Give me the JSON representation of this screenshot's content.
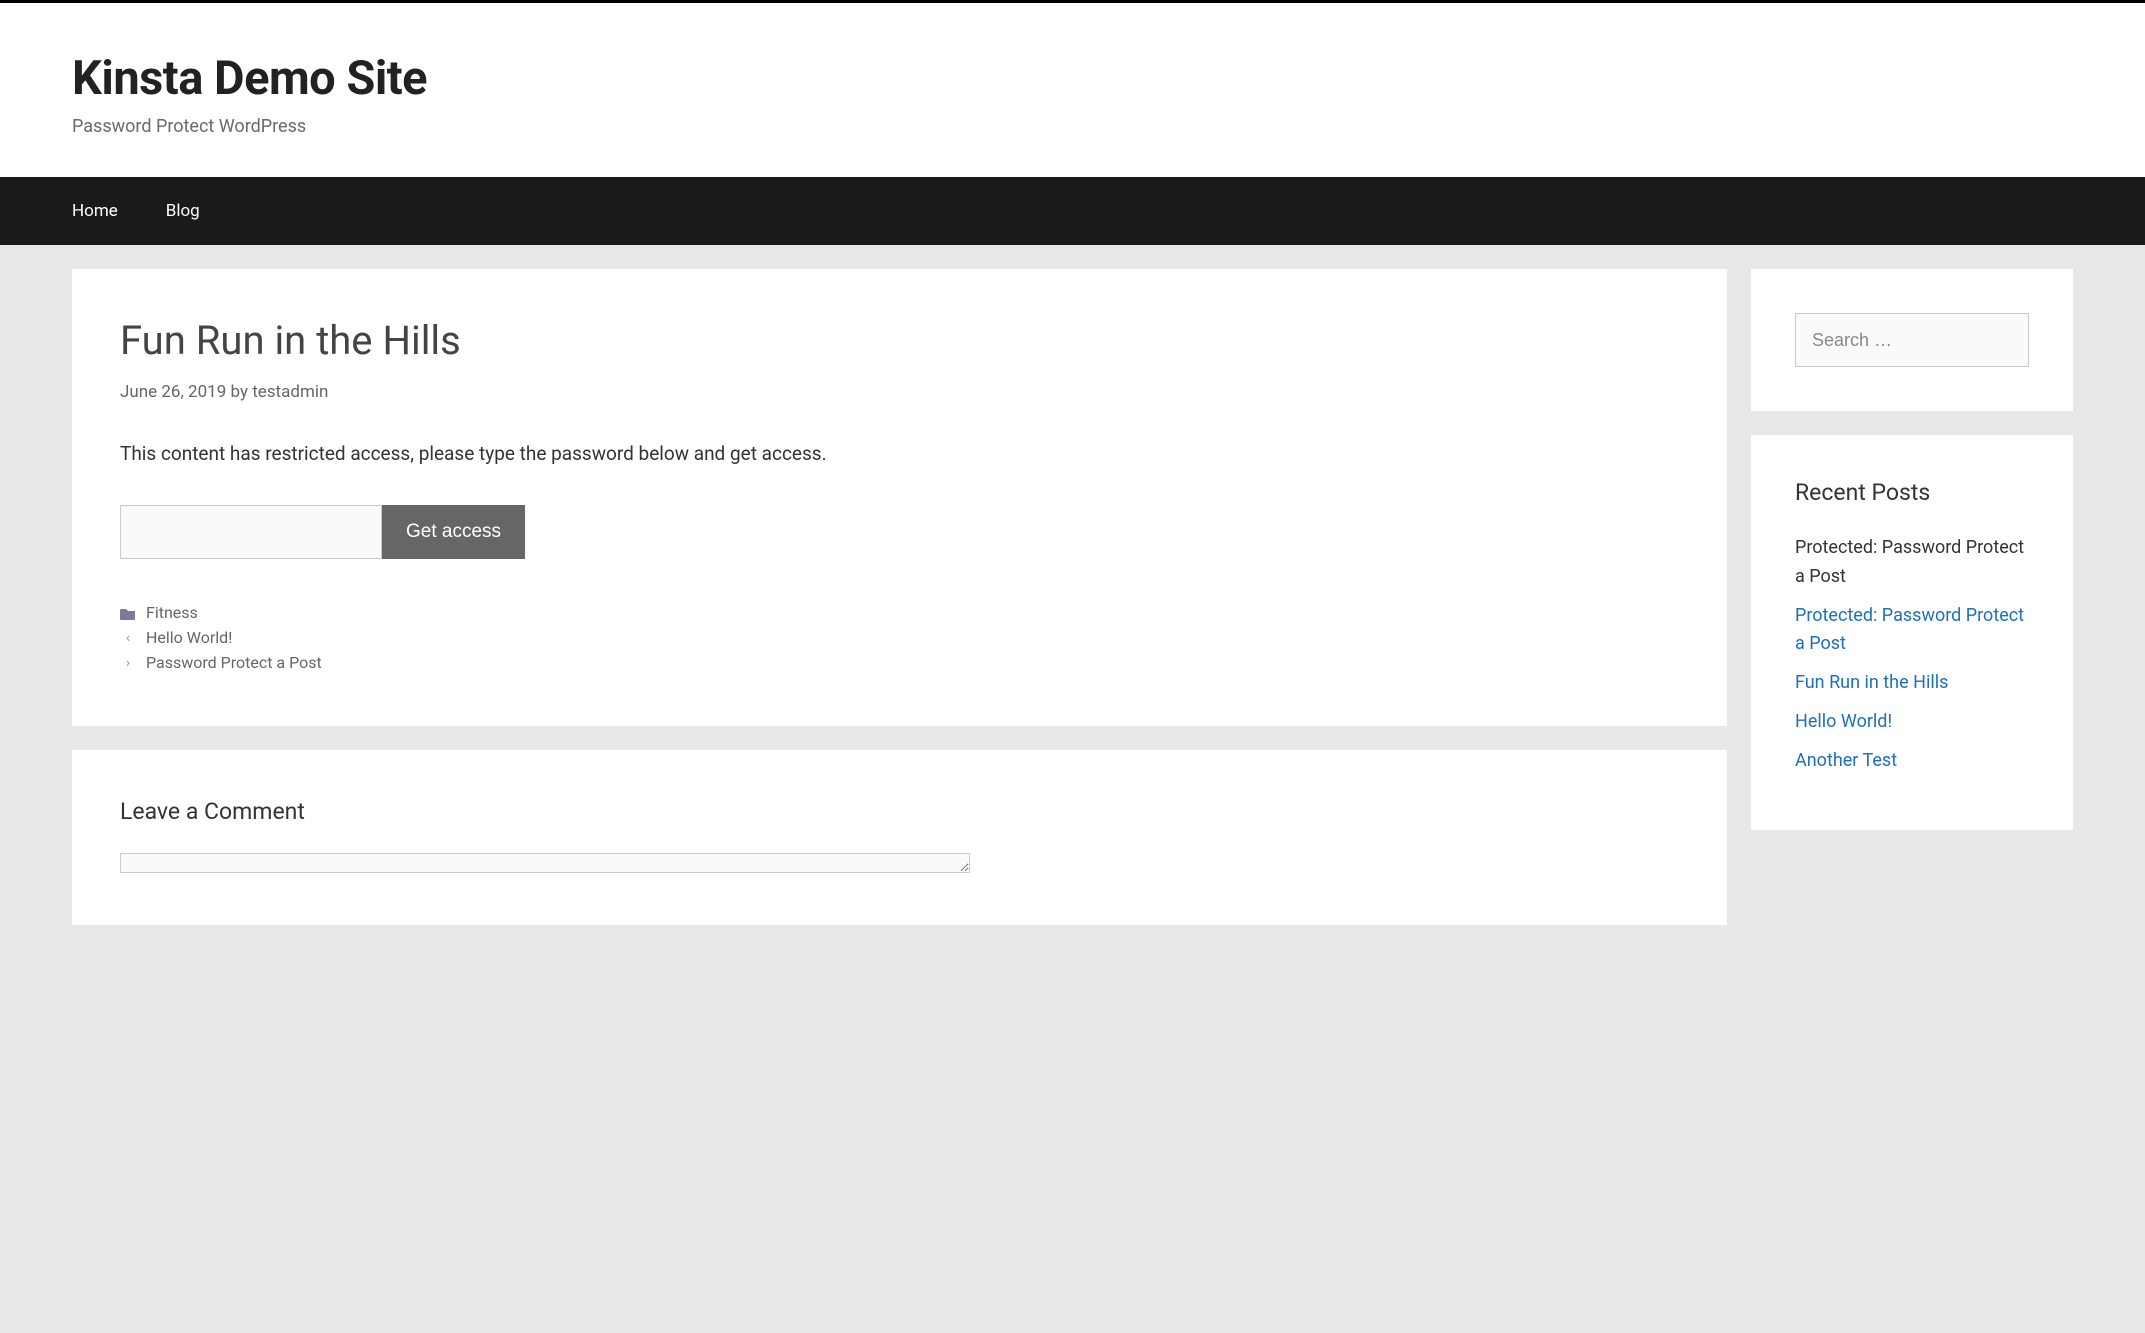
{
  "header": {
    "site_title": "Kinsta Demo Site",
    "tagline": "Password Protect WordPress"
  },
  "nav": {
    "items": [
      {
        "label": "Home"
      },
      {
        "label": "Blog"
      }
    ]
  },
  "post": {
    "title": "Fun Run in the Hills",
    "date": "June 26, 2019",
    "by_text": "by",
    "author": "testadmin",
    "restricted_msg": "This content has restricted access, please type the password below and get access.",
    "get_access_label": "Get access",
    "category": "Fitness",
    "prev_link": "Hello World!",
    "next_link": "Password Protect a Post"
  },
  "comments": {
    "title": "Leave a Comment"
  },
  "sidebar": {
    "search_placeholder": "Search …",
    "recent_title": "Recent Posts",
    "recent_posts": [
      {
        "label": "Protected: Password Protect a Post"
      },
      {
        "label": "Protected: Password Protect a Post"
      },
      {
        "label": "Fun Run in the Hills"
      },
      {
        "label": "Hello World!"
      },
      {
        "label": "Another Test"
      }
    ]
  }
}
